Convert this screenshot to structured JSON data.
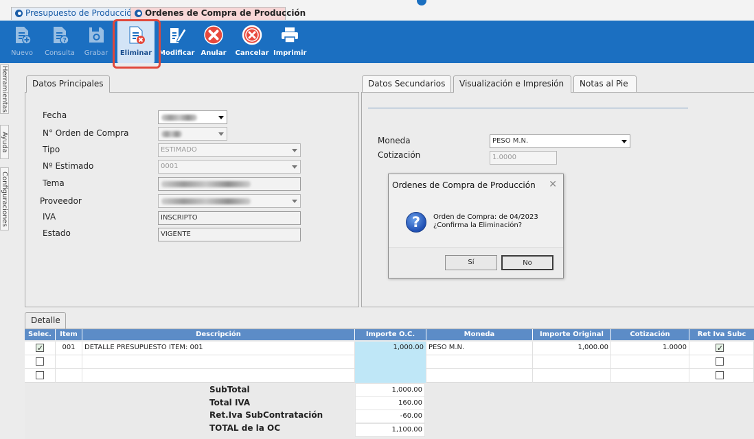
{
  "tabs": {
    "presupuesto": "Presupuesto de Producción",
    "ordenes": "Ordenes de Compra de Producción"
  },
  "toolbar": {
    "nuevo": "Nuevo",
    "consulta": "Consulta",
    "grabar": "Grabar",
    "eliminar": "Eliminar",
    "modificar": "Modificar",
    "anular": "Anular",
    "cancelar": "Cancelar",
    "imprimir": "Imprimir"
  },
  "side_tabs": {
    "herramientas": "Herramientas",
    "ayuda": "Ayuda",
    "configuraciones": "Configuraciones"
  },
  "main_tabs": {
    "datos_principales": "Datos Principales",
    "datos_secundarios": "Datos Secundarios",
    "visualizacion": "Visualización e Impresión",
    "notas": "Notas al Pie",
    "detalle": "Detalle"
  },
  "form": {
    "fecha_label": "Fecha",
    "orden_label": "N° Orden de Compra",
    "tipo_label": "Tipo",
    "tipo_value": "ESTIMADO",
    "estimado_label": "Nº Estimado",
    "estimado_value": "0001",
    "tema_label": "Tema",
    "proveedor_label": "Proveedor",
    "iva_label": "IVA",
    "iva_value": "INSCRIPTO",
    "estado_label": "Estado",
    "estado_value": "VIGENTE"
  },
  "right_form": {
    "moneda_label": "Moneda",
    "moneda_value": "PESO M.N.",
    "cotizacion_label": "Cotización",
    "cotizacion_value": "1.0000"
  },
  "dialog": {
    "title": "Ordenes de Compra de Producción",
    "close": "✕",
    "line1": "Orden de Compra:  de 04/2023",
    "line2": "¿Confirma la Eliminación?",
    "si": "Sí",
    "no": "No"
  },
  "grid": {
    "headers": [
      "Selec.",
      "Item",
      "Descripción",
      "Importe O.C.",
      "Moneda",
      "Importe Original",
      "Cotización",
      "Ret Iva Subc"
    ],
    "row1": {
      "item": "001",
      "descripcion": "DETALLE PRESUPUESTO ITEM: 001",
      "importe": "1,000.00",
      "moneda": "PESO M.N.",
      "importe_original": "1,000.00",
      "cotizacion": "1.0000"
    }
  },
  "totals": {
    "subtotal_label": "SubTotal",
    "subtotal": "1,000.00",
    "iva_label": "Total IVA",
    "iva": "160.00",
    "ret_label": "Ret.Iva SubContratación",
    "ret": "-60.00",
    "total_label": "TOTAL de la OC",
    "total": "1,100.00"
  },
  "colors": {
    "toolbar": "#1b6fc1",
    "grid_header": "#5c8cc7",
    "highlight": "#e0473a"
  }
}
